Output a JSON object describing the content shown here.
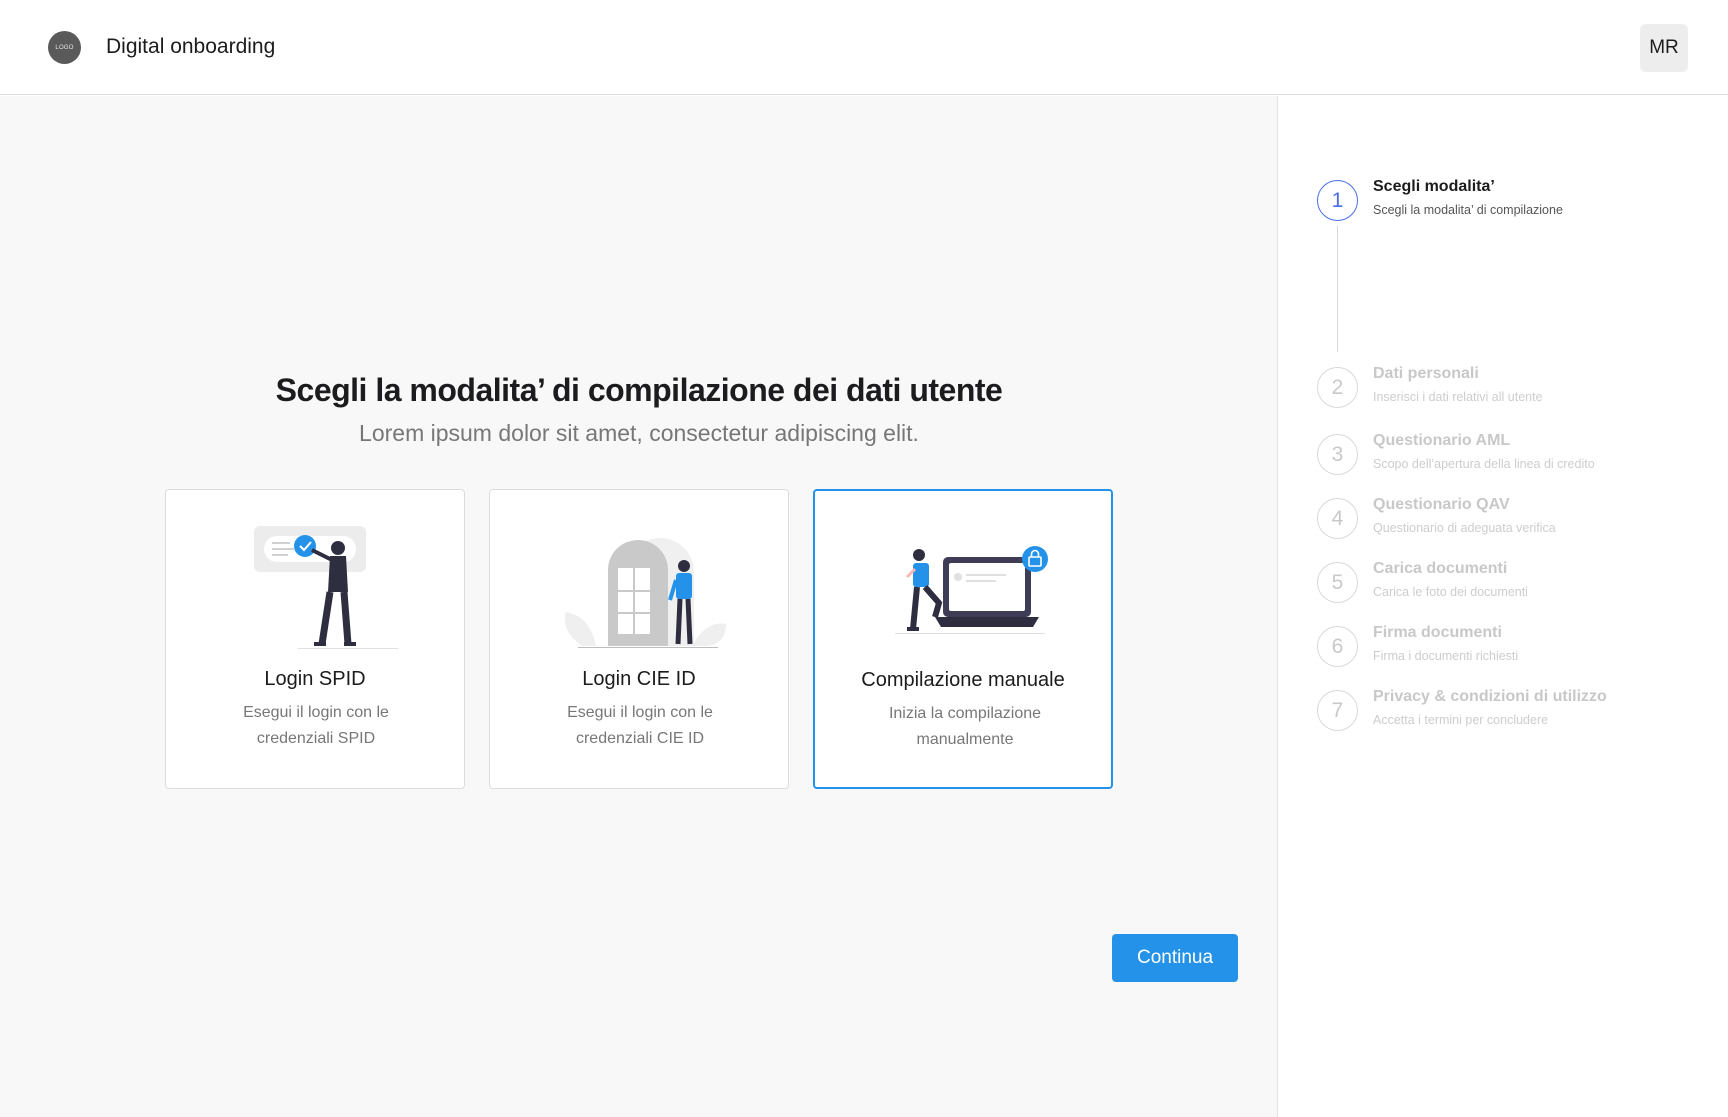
{
  "header": {
    "logo_text": "LOGO",
    "title": "Digital onboarding",
    "avatar_initials": "MR"
  },
  "main": {
    "title": "Scegli la modalita’ di compilazione dei dati utente",
    "subtitle": "Lorem ipsum dolor sit amet, consectetur adipiscing elit.",
    "cards": [
      {
        "title": "Login SPID",
        "description": "Esegui il login con le credenziali SPID",
        "selected": false,
        "illustration": "person-verification-illustration"
      },
      {
        "title": "Login CIE ID",
        "description": "Esegui il login con le credenziali CIE ID",
        "selected": false,
        "illustration": "person-door-illustration"
      },
      {
        "title": "Compilazione manuale",
        "description": "Inizia la compilazione manualmente",
        "selected": true,
        "illustration": "person-laptop-lock-illustration"
      }
    ],
    "continue_label": "Continua"
  },
  "stepper": {
    "steps": [
      {
        "number": "1",
        "title": "Scegli modalita’",
        "description": "Scegli la modalita’ di compilazione",
        "active": true
      },
      {
        "number": "2",
        "title": "Dati personali",
        "description": "Inserisci i dati relativi all utente",
        "active": false
      },
      {
        "number": "3",
        "title": "Questionario AML",
        "description": "Scopo dell’apertura della linea di credito",
        "active": false
      },
      {
        "number": "4",
        "title": "Questionario QAV",
        "description": "Questionario di adeguata verifica",
        "active": false
      },
      {
        "number": "5",
        "title": "Carica documenti",
        "description": "Carica le foto dei documenti",
        "active": false
      },
      {
        "number": "6",
        "title": "Firma documenti",
        "description": "Firma i documenti richiesti",
        "active": false
      },
      {
        "number": "7",
        "title": "Privacy &  condizioni di utilizzo",
        "description": "Accetta i termini per concludere",
        "active": false
      }
    ]
  },
  "colors": {
    "accent": "#2392e8",
    "step_active": "#4a6ee8",
    "illustration_dark": "#2f2e41",
    "illustration_light": "#e6e6e6"
  }
}
